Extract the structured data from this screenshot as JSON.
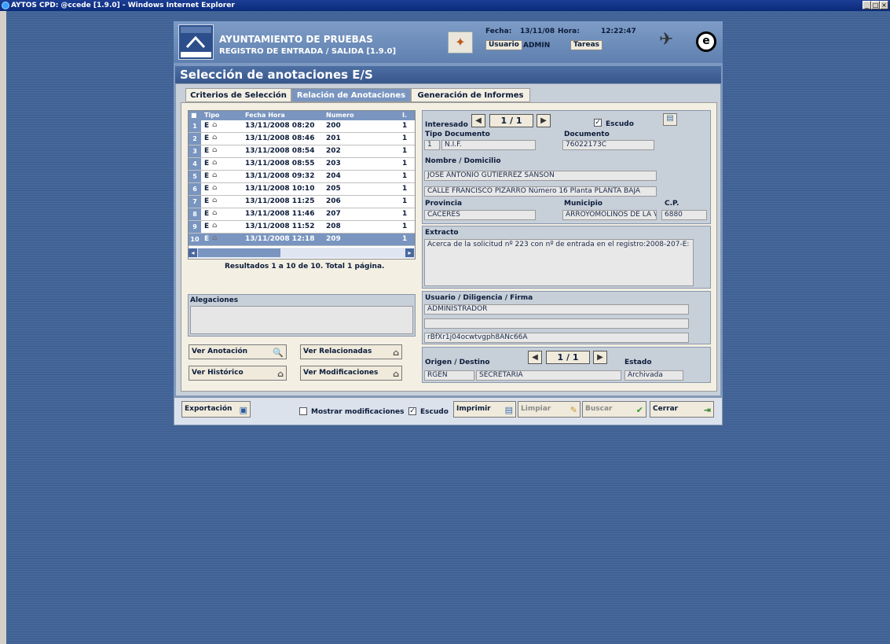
{
  "window": {
    "title": "AYTOS CPD: @ccede [1.9.0] - Windows Internet Explorer"
  },
  "header": {
    "org": "AYUNTAMIENTO DE PRUEBAS",
    "subtitle": "REGISTRO DE ENTRADA / SALIDA [1.9.0]",
    "fecha_label": "Fecha:",
    "fecha": "13/11/08",
    "hora_label": "Hora:",
    "hora": "12:22:47",
    "usuario_label": "Usuario",
    "usuario": "ADMIN",
    "tareas": "Tareas"
  },
  "page": {
    "title": "Selección de anotaciones E/S"
  },
  "tabs": [
    "Criterios de Selección",
    "Relación de Anotaciones",
    "Generación de Informes"
  ],
  "grid": {
    "headers": [
      "Tipo",
      "Fecha Hora",
      "Numero",
      "I."
    ],
    "rows": [
      {
        "n": "1",
        "tipo": "E",
        "fecha": "13/11/2008 08:20",
        "numero": "200",
        "i": "1"
      },
      {
        "n": "2",
        "tipo": "E",
        "fecha": "13/11/2008 08:46",
        "numero": "201",
        "i": "1"
      },
      {
        "n": "3",
        "tipo": "E",
        "fecha": "13/11/2008 08:54",
        "numero": "202",
        "i": "1"
      },
      {
        "n": "4",
        "tipo": "E",
        "fecha": "13/11/2008 08:55",
        "numero": "203",
        "i": "1"
      },
      {
        "n": "5",
        "tipo": "E",
        "fecha": "13/11/2008 09:32",
        "numero": "204",
        "i": "1"
      },
      {
        "n": "6",
        "tipo": "E",
        "fecha": "13/11/2008 10:10",
        "numero": "205",
        "i": "1"
      },
      {
        "n": "7",
        "tipo": "E",
        "fecha": "13/11/2008 11:25",
        "numero": "206",
        "i": "1"
      },
      {
        "n": "8",
        "tipo": "E",
        "fecha": "13/11/2008 11:46",
        "numero": "207",
        "i": "1"
      },
      {
        "n": "9",
        "tipo": "E",
        "fecha": "13/11/2008 11:52",
        "numero": "208",
        "i": "1"
      },
      {
        "n": "10",
        "tipo": "E",
        "fecha": "13/11/2008 12:18",
        "numero": "209",
        "i": "1"
      }
    ],
    "results": "Resultados 1 a 10 de 10. Total 1 página."
  },
  "alegaciones": {
    "label": "Alegaciones"
  },
  "buttons": {
    "ver_anotacion": "Ver Anotación",
    "ver_relacionadas": "Ver Relacionadas",
    "ver_historico": "Ver Histórico",
    "ver_modificaciones": "Ver Modificaciones"
  },
  "interesado": {
    "label": "Interesado",
    "counter": "1 / 1",
    "escudo": "Escudo",
    "tipo_doc_label": "Tipo Documento",
    "tipo_doc_code": "1",
    "tipo_doc": "N.I.F.",
    "documento_label": "Documento",
    "documento": "76022173C",
    "nombre_label": "Nombre / Domicilio",
    "nombre": "JOSE ANTONIO GUTIERREZ SANSON",
    "domicilio": "CALLE FRANCISCO PIZARRO Número 16 Planta PLANTA BAJA",
    "provincia_label": "Provincia",
    "provincia": "CÁCERES",
    "municipio_label": "Municipio",
    "municipio": "ARROYOMOLINOS DE LA VERA",
    "cp_label": "C.P.",
    "cp": "6880"
  },
  "extracto": {
    "label": "Extracto",
    "text": "Acerca de la solicitud nº 223 con nº de entrada en el registro:2008-207-E:"
  },
  "usuario": {
    "label": "Usuario / Diligencia / Firma",
    "line1": "ADMINISTRADOR",
    "line2": "",
    "line3": "rBfXr1j04ocwtvgph8ANc66A"
  },
  "origen": {
    "label": "Origen / Destino",
    "counter": "1 / 1",
    "code": "RGEN",
    "name": "SECRETARIA",
    "estado_label": "Estado",
    "estado": "Archivada"
  },
  "footer": {
    "exportacion": "Exportación",
    "mostrar": "Mostrar modificaciones",
    "escudo": "Escudo",
    "imprimir": "Imprimir",
    "limpiar": "Limpiar",
    "buscar": "Buscar",
    "cerrar": "Cerrar"
  }
}
